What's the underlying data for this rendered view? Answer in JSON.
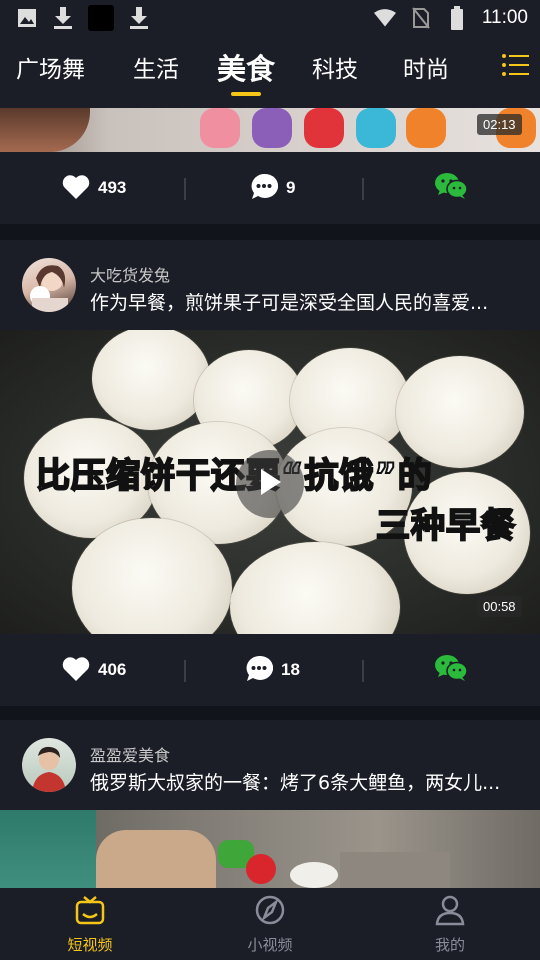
{
  "status_bar": {
    "time": "11:00",
    "icons": [
      "image-icon",
      "download-icon",
      "app-icon",
      "download-icon",
      "wifi-icon",
      "no-sim-icon",
      "battery-icon"
    ]
  },
  "tabs": [
    {
      "label": "广场舞",
      "active": false
    },
    {
      "label": "生活",
      "active": false
    },
    {
      "label": "美食",
      "active": true
    },
    {
      "label": "科技",
      "active": false
    },
    {
      "label": "时尚",
      "active": false
    }
  ],
  "colors": {
    "accent": "#f5c518",
    "background": "#1b1d27",
    "wechat": "#2bba3b"
  },
  "feed": [
    {
      "duration": "02:13",
      "likes": "493",
      "comments": "9",
      "share_icon": "wechat-icon"
    },
    {
      "author": "大吃货发兔",
      "title": "作为早餐，煎饼果子可是深受全国人民的喜爱...",
      "overlay_line1": "比压缩饼干还要“抗饿”的",
      "overlay_line2": "三种早餐",
      "duration": "00:58",
      "likes": "406",
      "comments": "18",
      "share_icon": "wechat-icon"
    },
    {
      "author": "盈盈爱美食",
      "title": "俄罗斯大叔家的一餐：烤了6条大鲤鱼，两女儿..."
    }
  ],
  "bottom_nav": [
    {
      "label": "短视频",
      "icon": "tv-icon",
      "active": true
    },
    {
      "label": "小视频",
      "icon": "compass-icon",
      "active": false
    },
    {
      "label": "我的",
      "icon": "user-icon",
      "active": false
    }
  ]
}
